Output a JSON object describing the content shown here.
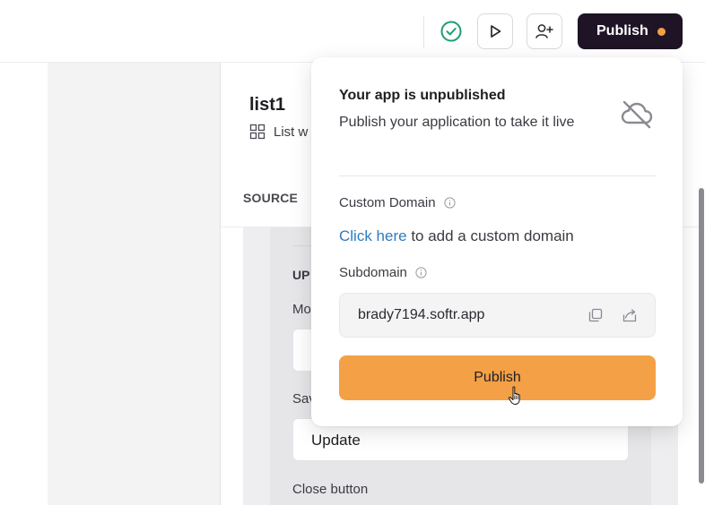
{
  "topbar": {
    "status_icon": "check-circle-icon",
    "preview_icon": "play-icon",
    "invite_icon": "add-user-icon",
    "publish_label": "Publish",
    "publish_dot_color": "#f59e42"
  },
  "panel": {
    "title": "list1",
    "subtitle": "List w",
    "subtitle_icon": "grid-icon",
    "tab_source": "SOURCE",
    "form": {
      "section_label": "UP",
      "field1_label": "Mo",
      "field2_label": "Sav",
      "field2_value": "Update",
      "field3_label": "Close button"
    }
  },
  "popover": {
    "title": "Your app is unpublished",
    "description": "Publish your application to take it live",
    "status_icon": "cloud-off-icon",
    "custom_domain_label": "Custom Domain",
    "custom_domain_link": "Click here",
    "custom_domain_text": " to add a custom domain",
    "subdomain_label": "Subdomain",
    "subdomain_value": "brady7194.softr.app",
    "publish_button": "Publish",
    "accent_color": "#f4a046"
  }
}
